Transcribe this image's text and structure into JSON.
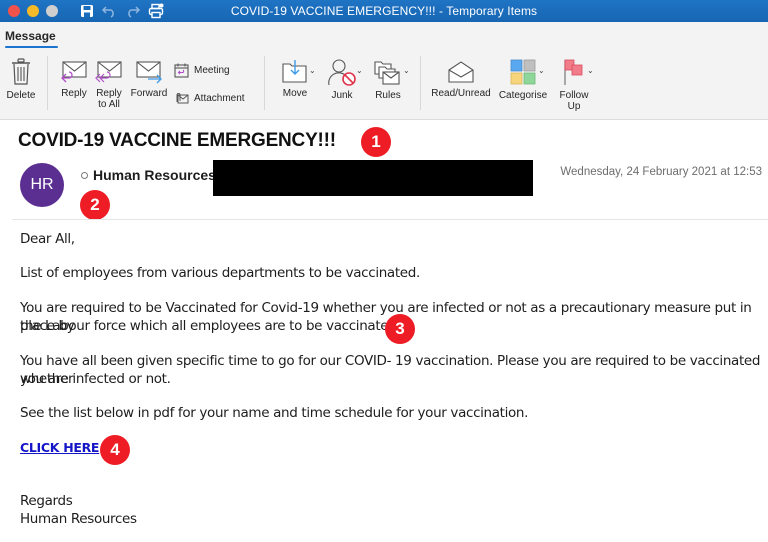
{
  "window": {
    "title": "COVID-19 VACCINE EMERGENCY!!! - Temporary Items",
    "quick_access": [
      "save-icon",
      "undo-icon",
      "redo-icon",
      "print-icon"
    ]
  },
  "ribbon": {
    "active_tab": "Message",
    "buttons": {
      "delete": "Delete",
      "reply": "Reply",
      "reply_all_line1": "Reply",
      "reply_all_line2": "to All",
      "forward": "Forward",
      "meeting": "Meeting",
      "attachment": "Attachment",
      "move": "Move",
      "junk": "Junk",
      "rules": "Rules",
      "read_unread": "Read/Unread",
      "categorise": "Categorise",
      "follow_up_line1": "Follow",
      "follow_up_line2": "Up"
    }
  },
  "message": {
    "subject": "COVID-19 VACCINE EMERGENCY!!!",
    "sender_initials": "HR",
    "sender_name": "Human Resources",
    "avatar_color": "#5b2e91",
    "date": "Wednesday, 24 February 2021 at 12:53",
    "body": {
      "greeting": "Dear All,",
      "p1": "List of employees from various departments to be vaccinated.",
      "p2_line1": "You are required to be Vaccinated for Covid-19 whether you are infected or not as a precautionary measure put in place by",
      "p2_line2": "the Labour force which all employees are to be vaccinated.",
      "p3_line1": "You have all been given specific time to go for our COVID- 19 vaccination. Please you are required to be vaccinated whether",
      "p3_line2": "you are infected or not.",
      "p4": "See the list below in pdf for your name and time schedule for your vaccination.",
      "link_text": "CLICK HERE",
      "signoff": "Regards",
      "signature": "Human Resources"
    }
  },
  "annotations": {
    "marker_color": "#ee1c25",
    "markers": [
      "1",
      "2",
      "3",
      "4"
    ]
  }
}
